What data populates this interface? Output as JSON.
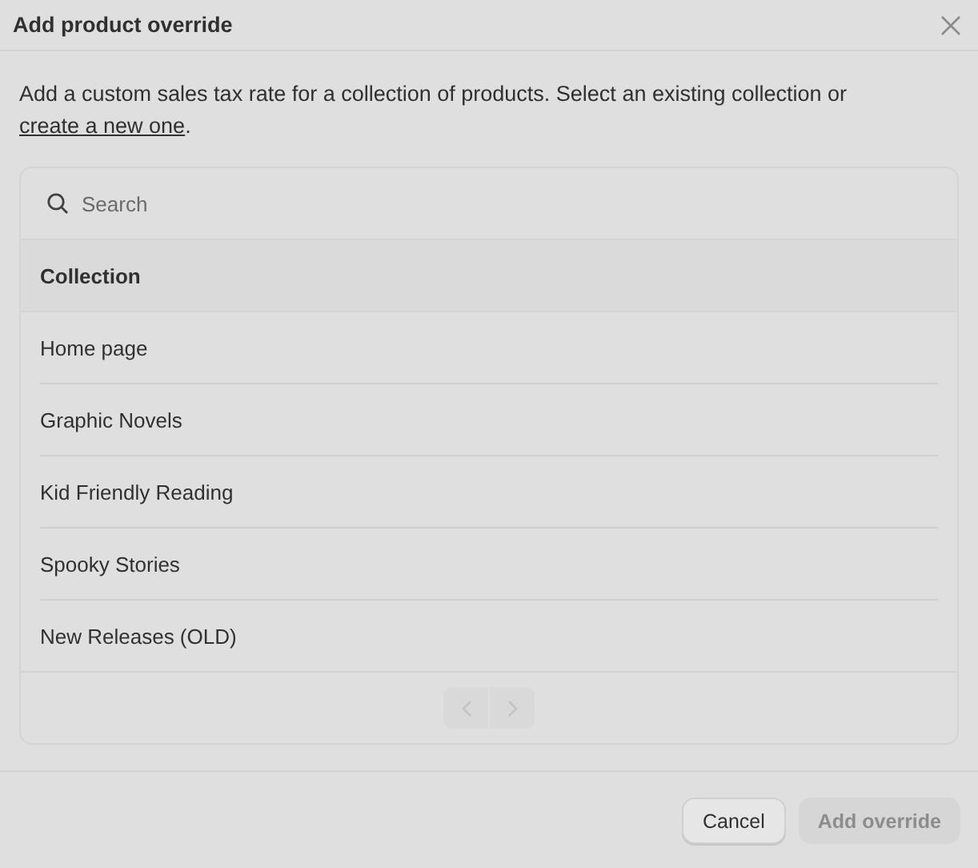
{
  "dialog": {
    "title": "Add product override"
  },
  "description": {
    "text": "Add a custom sales tax rate for a collection of products. Select an existing collection or ",
    "link": "create a new one",
    "after": "."
  },
  "search": {
    "placeholder": "Search"
  },
  "table": {
    "column": "Collection",
    "rows": [
      {
        "name": "Home page"
      },
      {
        "name": "Graphic Novels"
      },
      {
        "name": "Kid Friendly Reading"
      },
      {
        "name": "Spooky Stories"
      },
      {
        "name": "New Releases (OLD)"
      }
    ]
  },
  "pagination": {
    "previous_disabled": true,
    "next_disabled": true
  },
  "buttons": [
    {
      "label": "Cancel",
      "kind": "secondary",
      "disabled": false
    },
    {
      "label": "Add override",
      "kind": "primary",
      "disabled": true
    }
  ]
}
